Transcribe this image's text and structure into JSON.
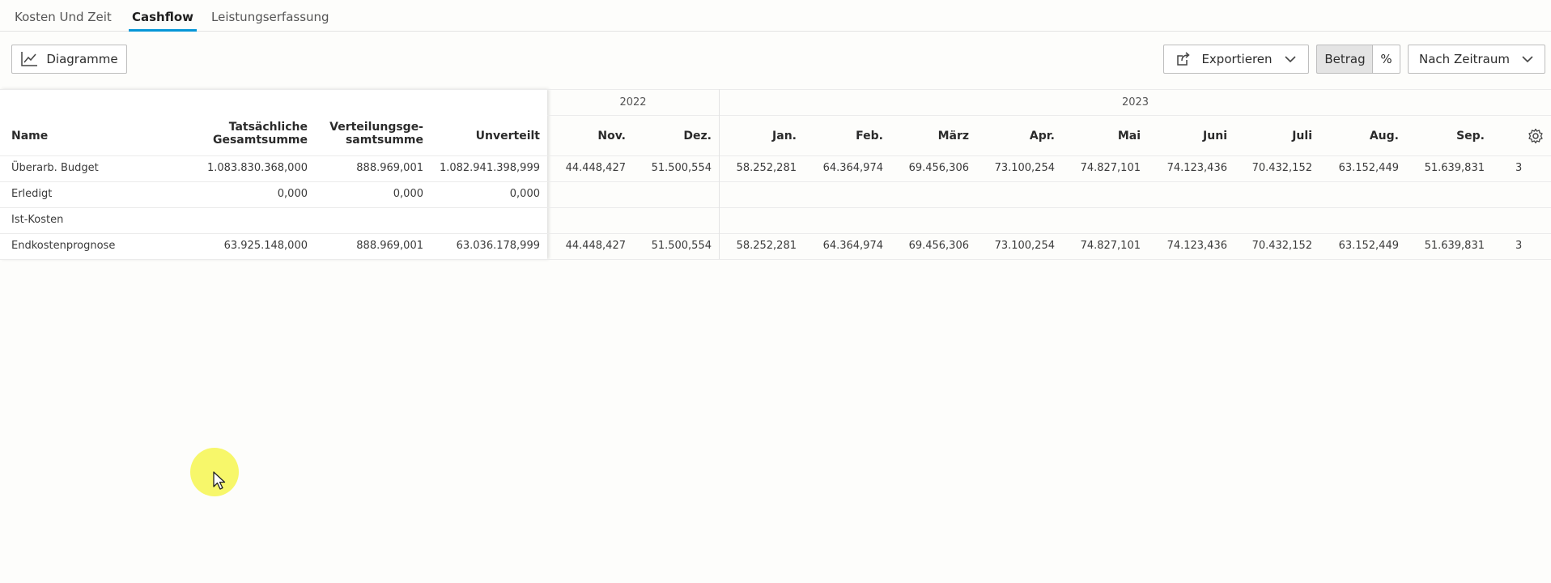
{
  "tabs": [
    "Kosten Und Zeit",
    "Cashflow",
    "Leistungserfassung"
  ],
  "active_tab": "Cashflow",
  "toolbar": {
    "diagramme": "Diagramme",
    "export": "Exportieren",
    "betrag": "Betrag",
    "percent": "%",
    "zeitraum": "Nach Zeitraum"
  },
  "table": {
    "years": [
      "2022",
      "2023"
    ],
    "header": {
      "name": "Name",
      "total_line1": "Tatsächliche",
      "total_line2": "Gesamtsumme",
      "dist_line1": "Verteilungsge-",
      "dist_line2": "samtsumme",
      "unverteilt": "Unverteilt"
    },
    "months": [
      "Nov.",
      "Dez.",
      "Jan.",
      "Feb.",
      "März",
      "Apr.",
      "Mai",
      "Juni",
      "Juli",
      "Aug.",
      "Sep."
    ],
    "rows": [
      {
        "name": "Überarb. Budget",
        "total": "1.083.830.368,000",
        "dist": "888.969,001",
        "unverteilt": "1.082.941.398,999",
        "months": [
          "44.448,427",
          "51.500,554",
          "58.252,281",
          "64.364,974",
          "69.456,306",
          "73.100,254",
          "74.827,101",
          "74.123,436",
          "70.432,152",
          "63.152,449",
          "51.639,831"
        ],
        "trail": "3"
      },
      {
        "name": "Erledigt",
        "total": "0,000",
        "dist": "0,000",
        "unverteilt": "0,000",
        "months": [
          "",
          "",
          "",
          "",
          "",
          "",
          "",
          "",
          "",
          "",
          ""
        ],
        "trail": ""
      },
      {
        "name": "Ist-Kosten",
        "total": "",
        "dist": "",
        "unverteilt": "",
        "months": [
          "",
          "",
          "",
          "",
          "",
          "",
          "",
          "",
          "",
          "",
          ""
        ],
        "trail": ""
      },
      {
        "name": "Endkostenprognose",
        "total": "63.925.148,000",
        "dist": "888.969,001",
        "unverteilt": "63.036.178,999",
        "months": [
          "44.448,427",
          "51.500,554",
          "58.252,281",
          "64.364,974",
          "69.456,306",
          "73.100,254",
          "74.827,101",
          "74.123,436",
          "70.432,152",
          "63.152,449",
          "51.639,831"
        ],
        "trail": "3"
      }
    ]
  },
  "icons": [
    "line-chart-icon",
    "export-icon",
    "chevron-down-icon",
    "gear-icon",
    "mouse-pointer-icon"
  ],
  "colors": {
    "accent": "#0696d7",
    "highlight": "#f6f650"
  }
}
